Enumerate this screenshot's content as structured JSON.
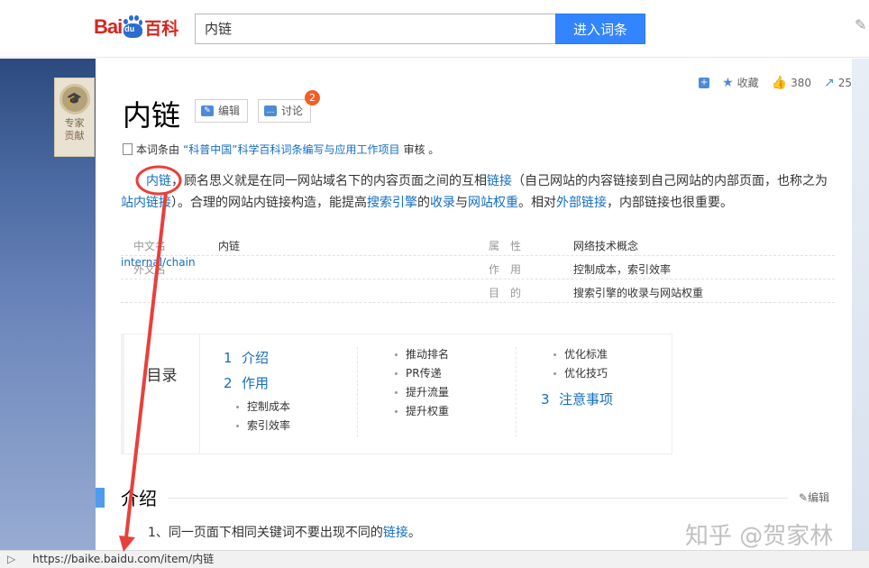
{
  "header": {
    "logo": {
      "part1": "Bai",
      "part2": "du",
      "part3": "百科"
    },
    "search_value": "内链",
    "search_button": "进入词条"
  },
  "expert": {
    "label": "专家贡献"
  },
  "topbar": {
    "collect": "收藏",
    "like_count": "380",
    "share_count": "25"
  },
  "entry": {
    "title": "内链",
    "edit_label": "编辑",
    "discuss_label": "讨论",
    "discuss_badge": "2",
    "review_prefix": "本词条由",
    "review_link": "“科普中国”科学百科词条编写与应用工作项目",
    "review_suffix": "审核 。"
  },
  "paragraph": {
    "link1": "内链",
    "t1": "，顾名思义就是在同一网站域名下的内容页面之间的互相",
    "link2": "链接",
    "t2": "（自己网站的内容链接到自己网站的内部页面，也称之为",
    "link3": "站内链接",
    "t3": "）。合理的网站内链接构造，能提高",
    "link4": "搜索引擎",
    "t4": "的",
    "link5": "收录",
    "t5": "与",
    "link6": "网站权重",
    "t6": "。相对",
    "link7": "外部链接",
    "t7": "，内部链接也很重要。"
  },
  "basic_info": {
    "rows": [
      {
        "l1": "中文名",
        "v1": "内链",
        "l2": "属　性",
        "v2": "网络技术概念"
      },
      {
        "l1": "外文名",
        "v1": "internal/chain",
        "l2": "作　用",
        "v2": "控制成本，索引效率"
      },
      {
        "l1": "",
        "v1": "",
        "l2": "目　的",
        "v2": "搜索引擎的收录与网站权重"
      }
    ]
  },
  "catalog": {
    "label": "目录",
    "h1_num": "1",
    "h1": "介绍",
    "h2_num": "2",
    "h2": "作用",
    "h2_sub": [
      "控制成本",
      "索引效率"
    ],
    "col2": [
      "推动排名",
      "PR传递",
      "提升流量",
      "提升权重"
    ],
    "col3": [
      "优化标准",
      "优化技巧"
    ],
    "h3_num": "3",
    "h3": "注意事项"
  },
  "section": {
    "title": "介绍",
    "edit": "编辑",
    "text_prefix": "1、同一页面下相同关键词不要出现不同的",
    "text_link": "链接",
    "text_suffix": "。"
  },
  "watermark": "知乎 @贺家林",
  "status_bar": {
    "url": "https://baike.baidu.com/item/内链"
  },
  "colors": {
    "accent": "#3385ff",
    "link": "#136ec2",
    "annotation": "#e8403a"
  }
}
